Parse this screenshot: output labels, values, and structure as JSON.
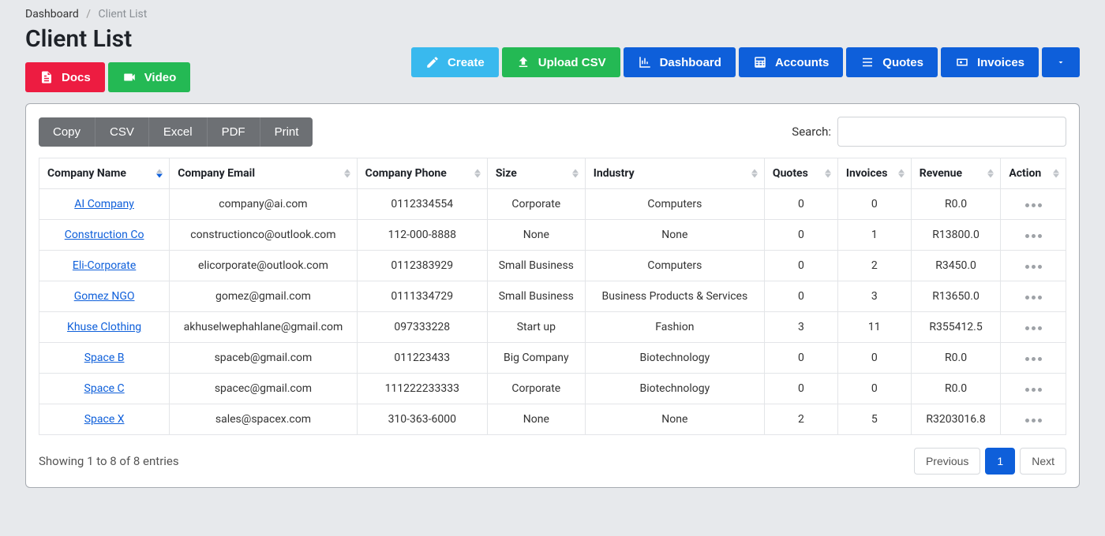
{
  "breadcrumb": {
    "root": "Dashboard",
    "current": "Client List"
  },
  "page_title": "Client List",
  "buttons_left": {
    "docs": "Docs",
    "video": "Video"
  },
  "buttons_right": {
    "create": "Create",
    "upload_csv": "Upload CSV",
    "dashboard": "Dashboard",
    "accounts": "Accounts",
    "quotes": "Quotes",
    "invoices": "Invoices"
  },
  "export_buttons": {
    "copy": "Copy",
    "csv": "CSV",
    "excel": "Excel",
    "pdf": "PDF",
    "print": "Print"
  },
  "search": {
    "label": "Search:",
    "value": ""
  },
  "table": {
    "columns": {
      "company_name": "Company Name",
      "company_email": "Company Email",
      "company_phone": "Company Phone",
      "size": "Size",
      "industry": "Industry",
      "quotes": "Quotes",
      "invoices": "Invoices",
      "revenue": "Revenue",
      "action": "Action"
    },
    "rows": [
      {
        "name": "AI Company",
        "email": "company@ai.com",
        "phone": "0112334554",
        "size": "Corporate",
        "industry": "Computers",
        "quotes": "0",
        "invoices": "0",
        "revenue": "R0.0"
      },
      {
        "name": "Construction Co",
        "email": "constructionco@outlook.com",
        "phone": "112-000-8888",
        "size": "None",
        "industry": "None",
        "quotes": "0",
        "invoices": "1",
        "revenue": "R13800.0"
      },
      {
        "name": "Eli-Corporate",
        "email": "elicorporate@outlook.com",
        "phone": "0112383929",
        "size": "Small Business",
        "industry": "Computers",
        "quotes": "0",
        "invoices": "2",
        "revenue": "R3450.0"
      },
      {
        "name": "Gomez NGO",
        "email": "gomez@gmail.com",
        "phone": "0111334729",
        "size": "Small Business",
        "industry": "Business Products & Services",
        "quotes": "0",
        "invoices": "3",
        "revenue": "R13650.0"
      },
      {
        "name": "Khuse Clothing",
        "email": "akhuselwephahlane@gmail.com",
        "phone": "097333228",
        "size": "Start up",
        "industry": "Fashion",
        "quotes": "3",
        "invoices": "11",
        "revenue": "R355412.5"
      },
      {
        "name": "Space B",
        "email": "spaceb@gmail.com",
        "phone": "011223433",
        "size": "Big Company",
        "industry": "Biotechnology",
        "quotes": "0",
        "invoices": "0",
        "revenue": "R0.0"
      },
      {
        "name": "Space C",
        "email": "spacec@gmail.com",
        "phone": "111222233333",
        "size": "Corporate",
        "industry": "Biotechnology",
        "quotes": "0",
        "invoices": "0",
        "revenue": "R0.0"
      },
      {
        "name": "Space X",
        "email": "sales@spacex.com",
        "phone": "310-363-6000",
        "size": "None",
        "industry": "None",
        "quotes": "2",
        "invoices": "5",
        "revenue": "R3203016.8"
      }
    ]
  },
  "footer": {
    "info": "Showing 1 to 8 of 8 entries",
    "previous": "Previous",
    "page": "1",
    "next": "Next"
  }
}
